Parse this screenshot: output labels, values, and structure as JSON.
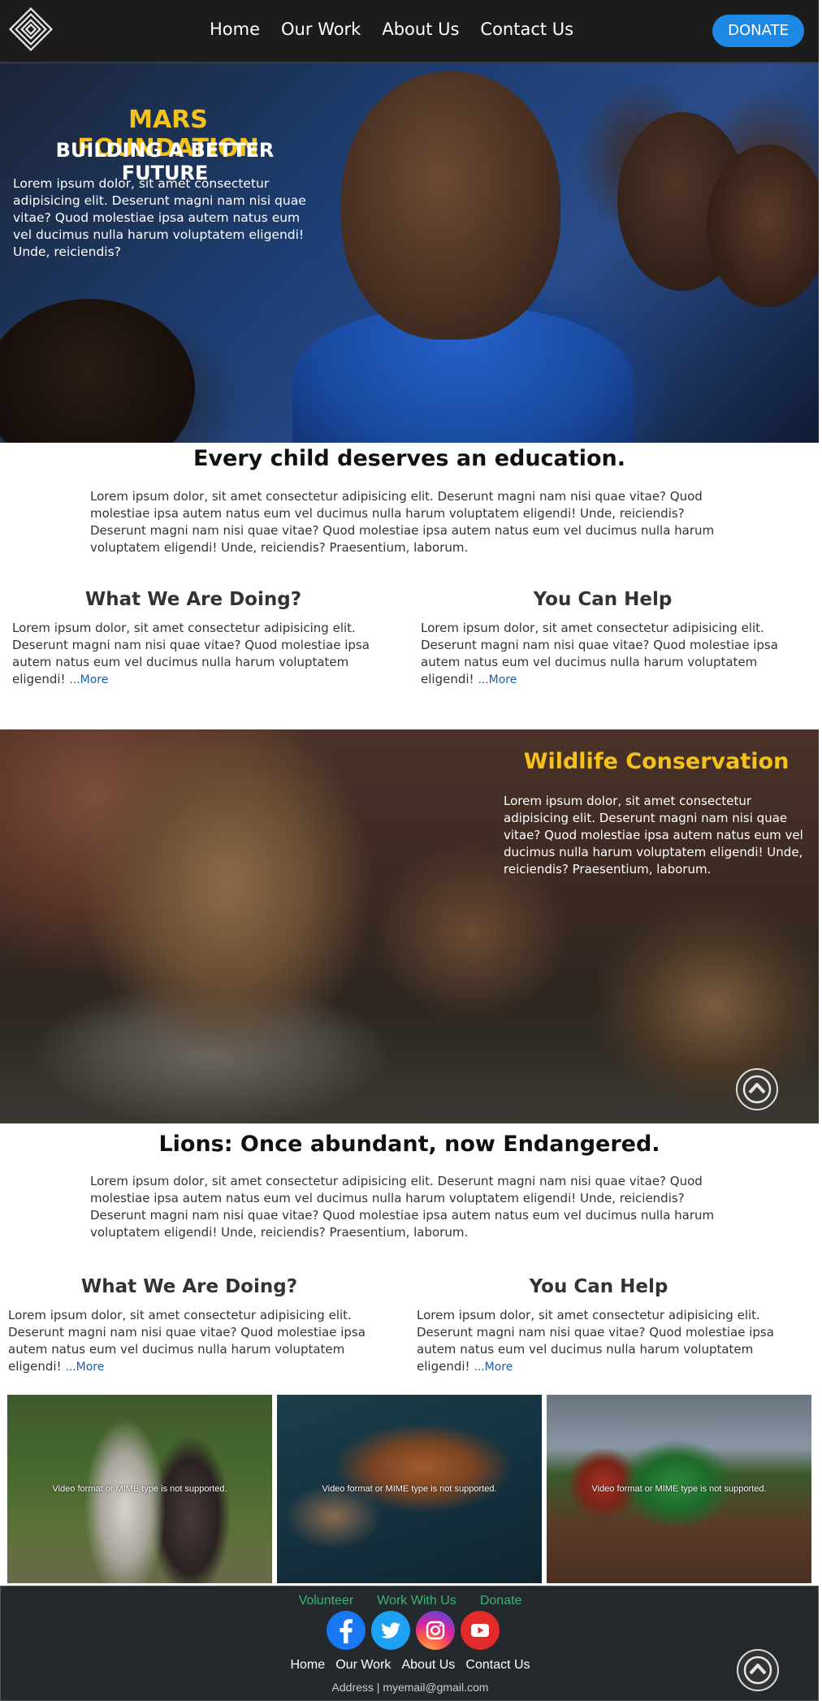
{
  "nav": {
    "links": [
      "Home",
      "Our Work",
      "About Us",
      "Contact Us"
    ],
    "donate": "DONATE"
  },
  "hero": {
    "title": "MARS FOUNDATION",
    "subtitle": "BUILDING A BETTER FUTURE",
    "text": "Lorem ipsum dolor, sit amet consectetur adipisicing elit. Deserunt magni nam nisi quae vitae? Quod molestiae ipsa autem natus eum vel ducimus nulla harum voluptatem eligendi! Unde, reiciendis?"
  },
  "education": {
    "heading": "Every child deserves an education.",
    "para1": "Lorem ipsum dolor, sit amet consectetur adipisicing elit. Deserunt magni nam nisi quae vitae? Quod molestiae ipsa autem natus eum vel ducimus nulla harum voluptatem eligendi! Unde, reiciendis?",
    "para2": "Deserunt magni nam nisi quae vitae? Quod molestiae ipsa autem natus eum vel ducimus nulla harum voluptatem eligendi! Unde, reiciendis? Praesentium, laborum.",
    "doing_heading": "What We Are Doing?",
    "doing_text": "Lorem ipsum dolor, sit amet consectetur adipisicing elit. Deserunt magni nam nisi quae vitae? Quod molestiae ipsa autem natus eum vel ducimus nulla harum voluptatem eligendi!",
    "help_heading": "You Can Help",
    "help_text": "Lorem ipsum dolor, sit amet consectetur adipisicing elit. Deserunt magni nam nisi quae vitae? Quod molestiae ipsa autem natus eum vel ducimus nulla harum voluptatem eligendi!",
    "more": "...More"
  },
  "wildlife": {
    "title": "Wildlife Conservation",
    "text": "Lorem ipsum dolor, sit amet consectetur adipisicing elit. Deserunt magni nam nisi quae vitae? Quod molestiae ipsa autem natus eum vel ducimus nulla harum voluptatem eligendi! Unde, reiciendis? Praesentium, laborum."
  },
  "lions": {
    "heading": "Lions: Once abundant, now Endangered.",
    "para1": "Lorem ipsum dolor, sit amet consectetur adipisicing elit. Deserunt magni nam nisi quae vitae? Quod molestiae ipsa autem natus eum vel ducimus nulla harum voluptatem eligendi! Unde, reiciendis?",
    "para2": "Deserunt magni nam nisi quae vitae? Quod molestiae ipsa autem natus eum vel ducimus nulla harum voluptatem eligendi! Unde, reiciendis? Praesentium, laborum.",
    "doing_heading": "What We Are Doing?",
    "doing_text": "Lorem ipsum dolor, sit amet consectetur adipisicing elit. Deserunt magni nam nisi quae vitae? Quod molestiae ipsa autem natus eum vel ducimus nulla harum voluptatem eligendi!",
    "help_heading": "You Can Help",
    "help_text": "Lorem ipsum dolor, sit amet consectetur adipisicing elit. Deserunt magni nam nisi quae vitae? Quod molestiae ipsa autem natus eum vel ducimus nulla harum voluptatem eligendi!",
    "more": "...More"
  },
  "videos": {
    "unsupported": "Video format or MIME type is not supported."
  },
  "footer": {
    "quick_links": [
      "Volunteer",
      "Work With Us",
      "Donate"
    ],
    "socials": [
      "facebook-icon",
      "twitter-icon",
      "instagram-icon",
      "youtube-icon"
    ],
    "nav": [
      "Home",
      "Our Work",
      "About Us",
      "Contact Us"
    ],
    "contact": "Address | myemail@gmail.com"
  },
  "colors": {
    "nav_bg": "#1c1c1c",
    "accent_blue": "#1e88e5",
    "hero_title": "#f4c21b",
    "footer_bg": "#24292e",
    "footer_link_green": "#3cb371"
  }
}
